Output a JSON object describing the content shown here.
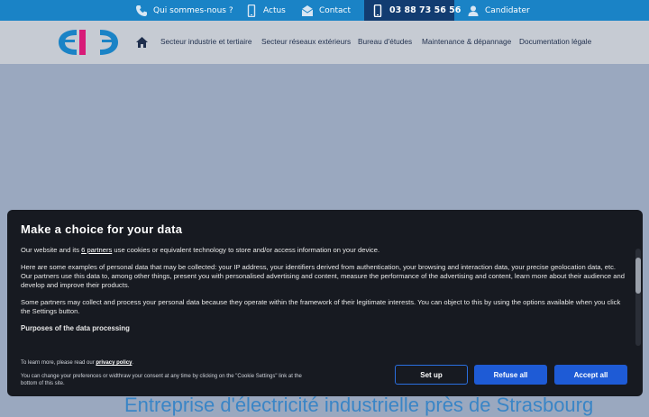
{
  "topbar": {
    "about_label": "Qui sommes-nous ?",
    "news_label": "Actus",
    "contact_label": "Contact",
    "phone_label": "03 88 73 56 56",
    "apply_label": "Candidater"
  },
  "nav": {
    "logo_text": "EIE",
    "items": [
      {
        "label": "Secteur industrie et tertiaire"
      },
      {
        "label": "Secteur réseaux extérieurs"
      },
      {
        "label": "Bureau d'études"
      },
      {
        "label": "Maintenance & dépannage"
      },
      {
        "label": "Documentation légale"
      }
    ]
  },
  "hero": {
    "headline": "Entreprise d'électricité industrielle près de Strasbourg"
  },
  "consent": {
    "title": "Make a choice for your data",
    "p1_before": "Our website and its ",
    "p1_link": "6 partners",
    "p1_after": " use cookies or equivalent technology to store and/or access information on your device.",
    "p2": "Here are some examples of personal data that may be collected: your IP address, your identifiers derived from authentication, your browsing and interaction data, your precise geolocation data, etc.",
    "p3": "Our partners use this data to, among other things, present you with personalised advertising and content, measure the performance of the advertising and content, learn more about their audience and develop and improve their products.",
    "p4": "Some partners may collect and process your personal data because they operate within the framework of their legitimate interests. You can object to this by using the options available when you click the Settings button.",
    "purposes_heading": "Purposes of the data processing",
    "foot1_before": "To learn more, please read our ",
    "foot1_link": "privacy policy",
    "foot1_after": ".",
    "foot2": "You can change your preferences or widthraw your consent at any time by clicking on the \"Cookie Settings\" link at the bottom of this site.",
    "setup_label": "Set up",
    "refuse_label": "Refuse all",
    "accept_label": "Accept all"
  },
  "colors": {
    "topbar": "#1a83c6",
    "phone_bg": "#123c71",
    "dialog_bg": "#171a21",
    "button_primary": "#1e5bd6",
    "logo_blue": "#1a83c6",
    "logo_pink": "#d81b78"
  }
}
